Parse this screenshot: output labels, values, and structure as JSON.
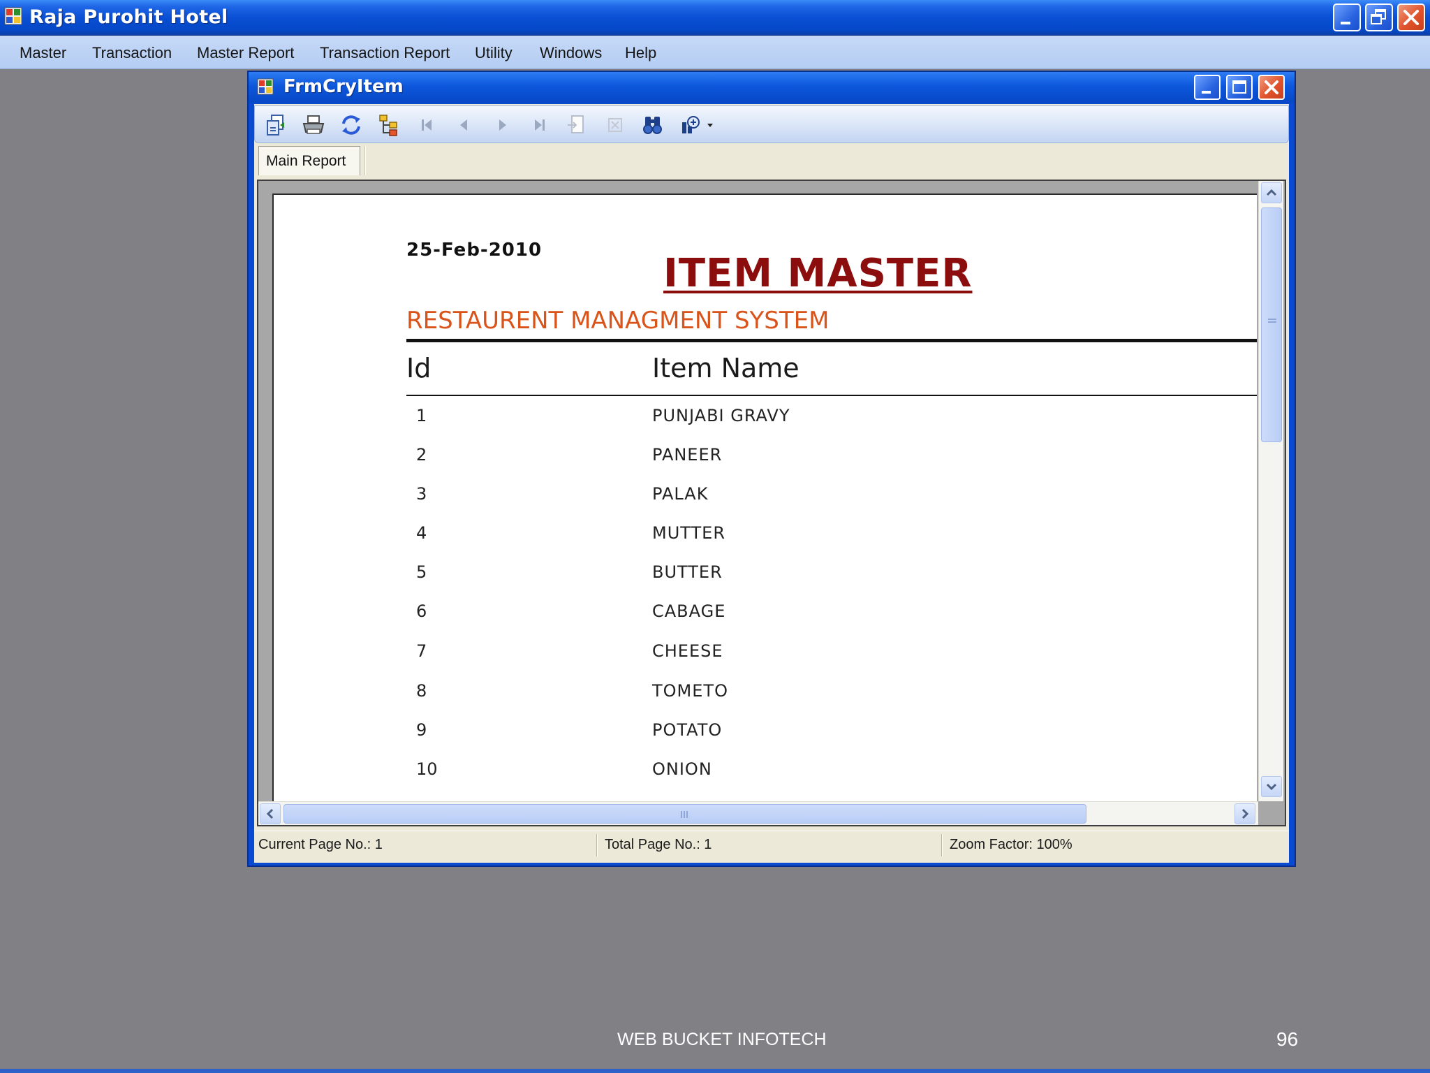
{
  "app": {
    "title": "Raja Purohit Hotel",
    "menu": [
      "Master",
      "Transaction",
      "Master Report",
      "Transaction Report",
      "Utility",
      "Windows",
      "Help"
    ]
  },
  "child_window": {
    "title": "FrmCryItem",
    "toolbar_icons": [
      "export-icon",
      "print-icon",
      "refresh-icon",
      "group-tree-icon",
      "first-page-icon",
      "previous-page-icon",
      "next-page-icon",
      "last-page-icon",
      "goto-page-icon",
      "stop-icon",
      "search-icon",
      "zoom-icon"
    ],
    "tab": "Main Report"
  },
  "report": {
    "date": "25-Feb-2010",
    "title": "ITEM MASTER",
    "subtitle": "RESTAURENT MANAGMENT SYSTEM",
    "columns": [
      "Id",
      "Item Name"
    ],
    "rows": [
      {
        "id": "1",
        "name": "PUNJABI GRAVY"
      },
      {
        "id": "2",
        "name": "PANEER"
      },
      {
        "id": "3",
        "name": "PALAK"
      },
      {
        "id": "4",
        "name": "MUTTER"
      },
      {
        "id": "5",
        "name": "BUTTER"
      },
      {
        "id": "6",
        "name": "CABAGE"
      },
      {
        "id": "7",
        "name": "CHEESE"
      },
      {
        "id": "8",
        "name": "TOMETO"
      },
      {
        "id": "9",
        "name": "POTATO"
      },
      {
        "id": "10",
        "name": "ONION"
      }
    ]
  },
  "status": {
    "current_page": "Current Page No.: 1",
    "total_pages": "Total Page No.: 1",
    "zoom": "Zoom Factor: 100%"
  },
  "footer": {
    "company": "WEB BUCKET INFOTECH",
    "slide_number": "96"
  },
  "colors": {
    "title_bar": "#0a4fd4",
    "report_title": "#8b0d0d",
    "report_subtitle": "#d9541a",
    "desktop": "#818085"
  }
}
